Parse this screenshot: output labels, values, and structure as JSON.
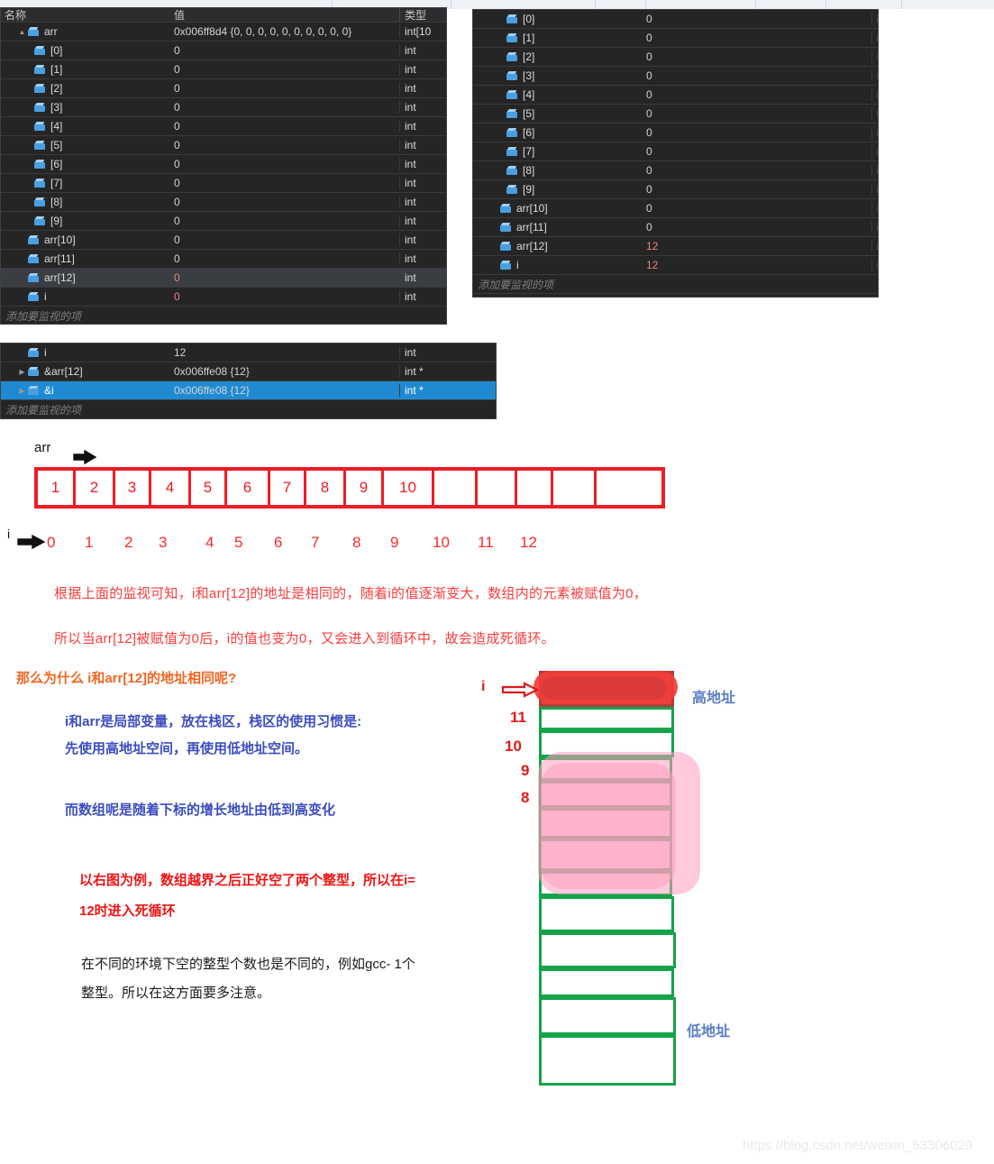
{
  "watch_panels": [
    {
      "id": "watch-1",
      "columns": [
        "名称",
        "值",
        "类型"
      ],
      "rows": [
        {
          "name": "arr",
          "indent": 0,
          "twisty": "▲",
          "value": "0x006ff8d4 {0, 0, 0, 0, 0, 0, 0, 0, 0, 0}",
          "type": "int[10",
          "changed": false
        },
        {
          "name": "[0]",
          "indent": 1,
          "value": "0",
          "type": "int",
          "changed": false
        },
        {
          "name": "[1]",
          "indent": 1,
          "value": "0",
          "type": "int",
          "changed": false
        },
        {
          "name": "[2]",
          "indent": 1,
          "value": "0",
          "type": "int",
          "changed": false
        },
        {
          "name": "[3]",
          "indent": 1,
          "value": "0",
          "type": "int",
          "changed": false
        },
        {
          "name": "[4]",
          "indent": 1,
          "value": "0",
          "type": "int",
          "changed": false
        },
        {
          "name": "[5]",
          "indent": 1,
          "value": "0",
          "type": "int",
          "changed": false
        },
        {
          "name": "[6]",
          "indent": 1,
          "value": "0",
          "type": "int",
          "changed": false
        },
        {
          "name": "[7]",
          "indent": 1,
          "value": "0",
          "type": "int",
          "changed": false
        },
        {
          "name": "[8]",
          "indent": 1,
          "value": "0",
          "type": "int",
          "changed": false
        },
        {
          "name": "[9]",
          "indent": 1,
          "value": "0",
          "type": "int",
          "changed": false
        },
        {
          "name": "arr[10]",
          "indent": 0,
          "value": "0",
          "type": "int",
          "changed": false
        },
        {
          "name": "arr[11]",
          "indent": 0,
          "value": "0",
          "type": "int",
          "changed": false
        },
        {
          "name": "arr[12]",
          "indent": 0,
          "value": "0",
          "type": "int",
          "changed": true,
          "selected": true
        },
        {
          "name": "i",
          "indent": 0,
          "value": "0",
          "type": "int",
          "changed": true
        }
      ],
      "add_watch_placeholder": "添加要监视的项"
    },
    {
      "id": "watch-2",
      "rows": [
        {
          "name": "[0]",
          "indent": 1,
          "value": "0",
          "type": "int",
          "changed": false
        },
        {
          "name": "[1]",
          "indent": 1,
          "value": "0",
          "type": "int",
          "changed": false
        },
        {
          "name": "[2]",
          "indent": 1,
          "value": "0",
          "type": "int",
          "changed": false
        },
        {
          "name": "[3]",
          "indent": 1,
          "value": "0",
          "type": "int",
          "changed": false
        },
        {
          "name": "[4]",
          "indent": 1,
          "value": "0",
          "type": "int",
          "changed": false
        },
        {
          "name": "[5]",
          "indent": 1,
          "value": "0",
          "type": "int",
          "changed": false
        },
        {
          "name": "[6]",
          "indent": 1,
          "value": "0",
          "type": "int",
          "changed": false
        },
        {
          "name": "[7]",
          "indent": 1,
          "value": "0",
          "type": "int",
          "changed": false
        },
        {
          "name": "[8]",
          "indent": 1,
          "value": "0",
          "type": "int",
          "changed": false
        },
        {
          "name": "[9]",
          "indent": 1,
          "value": "0",
          "type": "int",
          "changed": false
        },
        {
          "name": "arr[10]",
          "indent": 0,
          "value": "0",
          "type": "int",
          "changed": false
        },
        {
          "name": "arr[11]",
          "indent": 0,
          "value": "0",
          "type": "int",
          "changed": false
        },
        {
          "name": "arr[12]",
          "indent": 0,
          "value": "12",
          "type": "int",
          "changed": true
        },
        {
          "name": "i",
          "indent": 0,
          "value": "12",
          "type": "int",
          "changed": true
        }
      ],
      "add_watch_placeholder": "添加要监视的项"
    },
    {
      "id": "watch-3",
      "rows": [
        {
          "name": "i",
          "indent": 0,
          "value": "12",
          "type": "int",
          "changed": false
        },
        {
          "name": "&arr[12]",
          "indent": 0,
          "twisty": "▶",
          "value": "0x006ffe08 {12}",
          "type": "int *",
          "changed": false
        },
        {
          "name": "&i",
          "indent": 0,
          "twisty": "▶",
          "value": "0x006ffe08 {12}",
          "type": "int *",
          "changed": false,
          "selected_blue": true
        }
      ],
      "add_watch_placeholder": "添加要监视的项"
    }
  ],
  "array_diagram": {
    "pointer_label": "arr",
    "index_pointer_label": "i",
    "cell_values": [
      "1",
      "2",
      "3",
      "4",
      "5",
      "6",
      "7",
      "8",
      "9",
      "10",
      "",
      "",
      "",
      "",
      ""
    ],
    "indices": [
      "0",
      "1",
      "2",
      "3",
      "4",
      "5",
      "6",
      "7",
      "8",
      "9",
      "10",
      "11",
      "12"
    ]
  },
  "notes": {
    "red_line_1": "根据上面的监视可知，i和arr[12]的地址是相同的，随着i的值逐渐变大，数组内的元素被赋值为0，",
    "red_line_2": "所以当arr[12]被赋值为0后，i的值也变为0，又会进入到循环中，故会造成死循环。",
    "orange_heading": "那么为什么 i和arr[12]的地址相同呢?",
    "blue_line_1": "i和arr是局部变量，放在栈区，栈区的使用习惯是:",
    "blue_line_2": "先使用高地址空间，再使用低地址空间。",
    "blue_line_3": "而数组呢是随着下标的增长地址由低到高变化",
    "red_bold_1": "以右图为例，数组越界之后正好空了两个整型，所以在i=",
    "red_bold_2": "12时进入死循环",
    "black_line_1": "在不同的环境下空的整型个数也是不同的，例如gcc- 1个",
    "black_line_2": "整型。所以在这方面要多注意。"
  },
  "stack_diagram": {
    "i_label": "i",
    "high_address_label": "高地址",
    "low_address_label": "低地址",
    "cell_numbers": [
      "11",
      "10",
      "9",
      "8"
    ]
  },
  "watermark": "https://blog.csdn.net/weixin_53306029",
  "colors": {
    "panel_bg": "#252526",
    "panel_text": "#dcdcdc",
    "changed_value": "#e8867a",
    "selection_blue": "#1f8ad2",
    "array_red": "#ee1c24",
    "stack_green": "#16a34a",
    "heading_orange": "#f26522",
    "body_blue": "#3b4cc0",
    "note_red": "#fb3b3b"
  }
}
